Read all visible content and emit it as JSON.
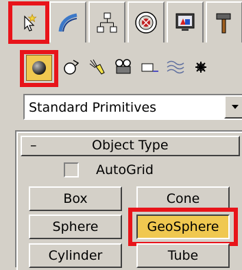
{
  "tabs": [
    {
      "name": "create-tab",
      "icon": "create-pointer-icon",
      "active": true
    },
    {
      "name": "modify-tab",
      "icon": "modify-arc-icon"
    },
    {
      "name": "hierarchy-tab",
      "icon": "hierarchy-icon"
    },
    {
      "name": "motion-tab",
      "icon": "motion-icon"
    },
    {
      "name": "display-tab",
      "icon": "display-icon"
    },
    {
      "name": "utilities-tab",
      "icon": "hammer-icon"
    }
  ],
  "subcategories": [
    {
      "name": "geometry",
      "icon": "sphere-icon",
      "active": true
    },
    {
      "name": "shapes",
      "icon": "shapes-icon"
    },
    {
      "name": "lights",
      "icon": "light-icon"
    },
    {
      "name": "cameras",
      "icon": "camera-icon"
    },
    {
      "name": "helpers",
      "icon": "helper-icon"
    },
    {
      "name": "space-warps",
      "icon": "spacewarp-icon"
    },
    {
      "name": "systems",
      "icon": "gear-icon"
    }
  ],
  "dropdown": {
    "value": "Standard Primitives"
  },
  "rollout": {
    "collapse_symbol": "–",
    "title": "Object Type",
    "autogrid_label": "AutoGrid",
    "buttons": [
      "Box",
      "Cone",
      "Sphere",
      "GeoSphere",
      "Cylinder",
      "Tube"
    ]
  },
  "colors": {
    "highlight": "#e8141a",
    "active_button": "#f0c850",
    "panel": "#d4d0c8"
  }
}
